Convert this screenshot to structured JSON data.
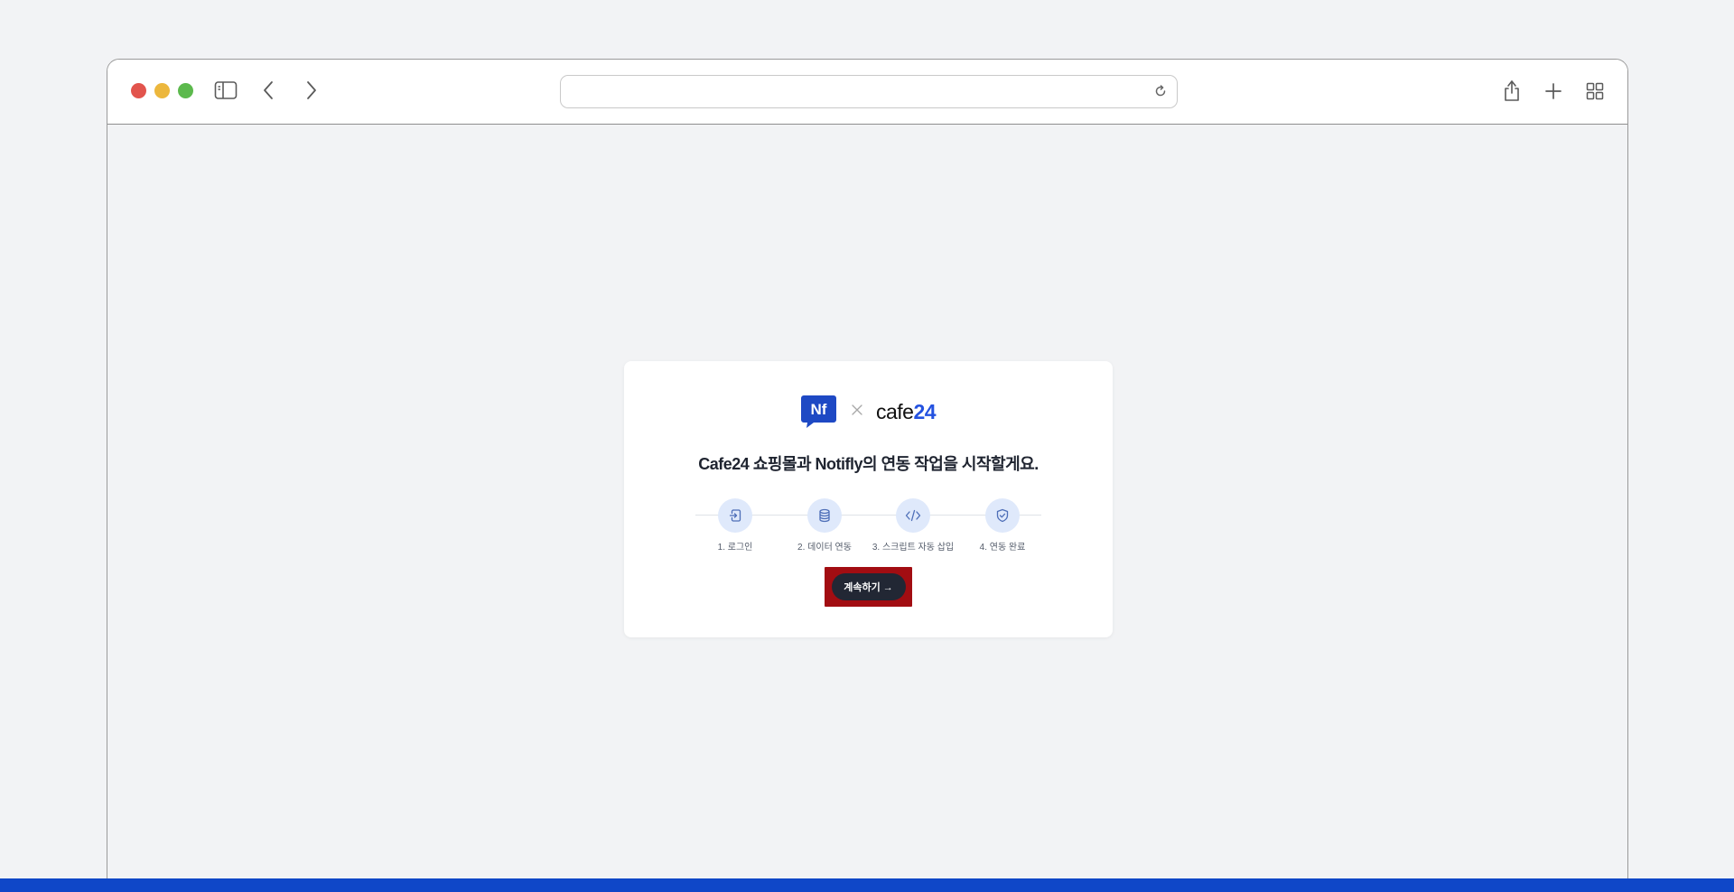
{
  "browser": {
    "url": "",
    "icons": {
      "sidebar": "sidebar-icon",
      "back": "chevron-left-icon",
      "forward": "chevron-right-icon",
      "reload": "reload-icon",
      "share": "share-icon",
      "new_tab": "plus-icon",
      "tabs": "tab-overview-icon"
    },
    "traffic_colors": [
      "#e2544d",
      "#ecb73d",
      "#5cb94d"
    ]
  },
  "card": {
    "logo_nf": "Nf",
    "logo_cafe_word": "cafe",
    "logo_cafe_num": "24",
    "headline": "Cafe24 쇼핑몰과 Notifly의 연동 작업을 시작할게요.",
    "steps": [
      {
        "label": "1. 로그인",
        "icon": "login-icon"
      },
      {
        "label": "2. 데이터 연동",
        "icon": "database-icon"
      },
      {
        "label": "3. 스크립트 자동 삽입",
        "icon": "code-icon"
      },
      {
        "label": "4. 연동 완료",
        "icon": "shield-check-icon"
      }
    ],
    "continue_label": "계속하기 →"
  },
  "colors": {
    "accent_dark": "#222734",
    "brand_blue": "#2452e0",
    "highlight_red": "#a20d12",
    "bottom_bar": "#0f47c8"
  }
}
